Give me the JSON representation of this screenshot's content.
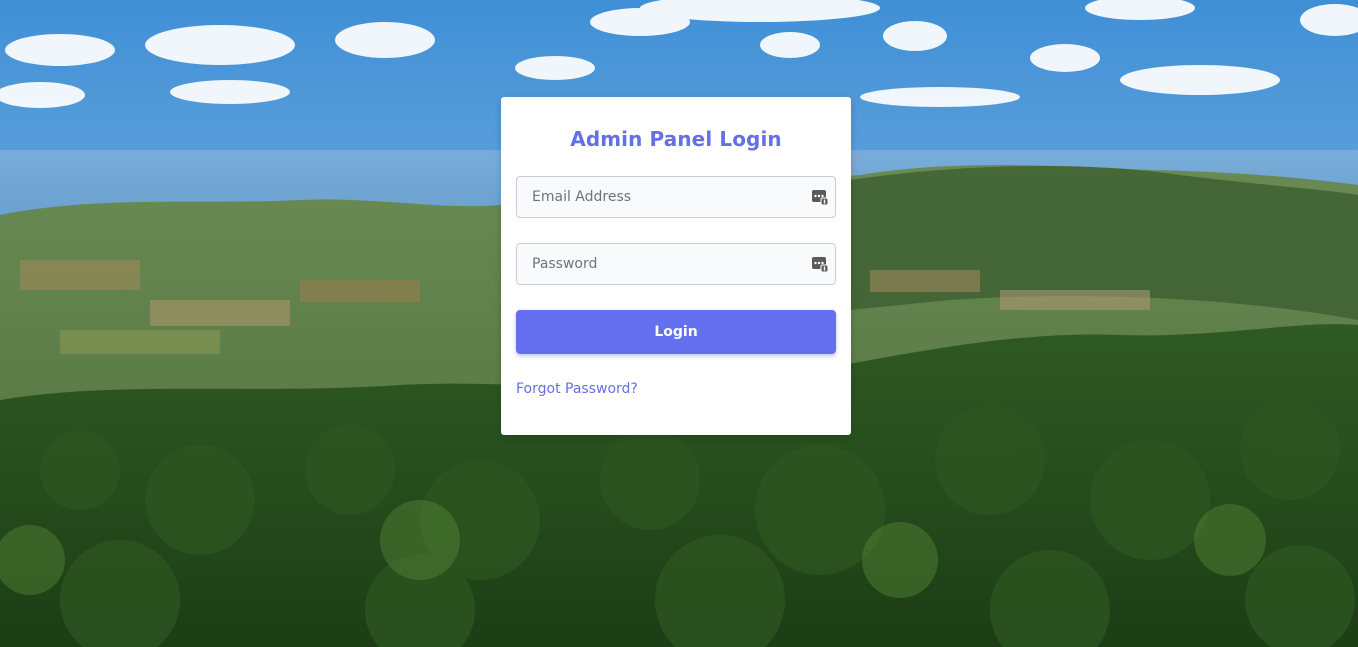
{
  "login": {
    "title": "Admin Panel Login",
    "email_placeholder": "Email Address",
    "password_placeholder": "Password",
    "email_value": "",
    "password_value": "",
    "login_label": "Login",
    "forgot_label": "Forgot Password?"
  },
  "icons": {
    "field_icon": "password-manager-key-icon"
  },
  "colors": {
    "accent": "#6470f0",
    "title": "#6470e3",
    "card_bg": "#ffffff",
    "field_bg": "#f8fafc"
  }
}
